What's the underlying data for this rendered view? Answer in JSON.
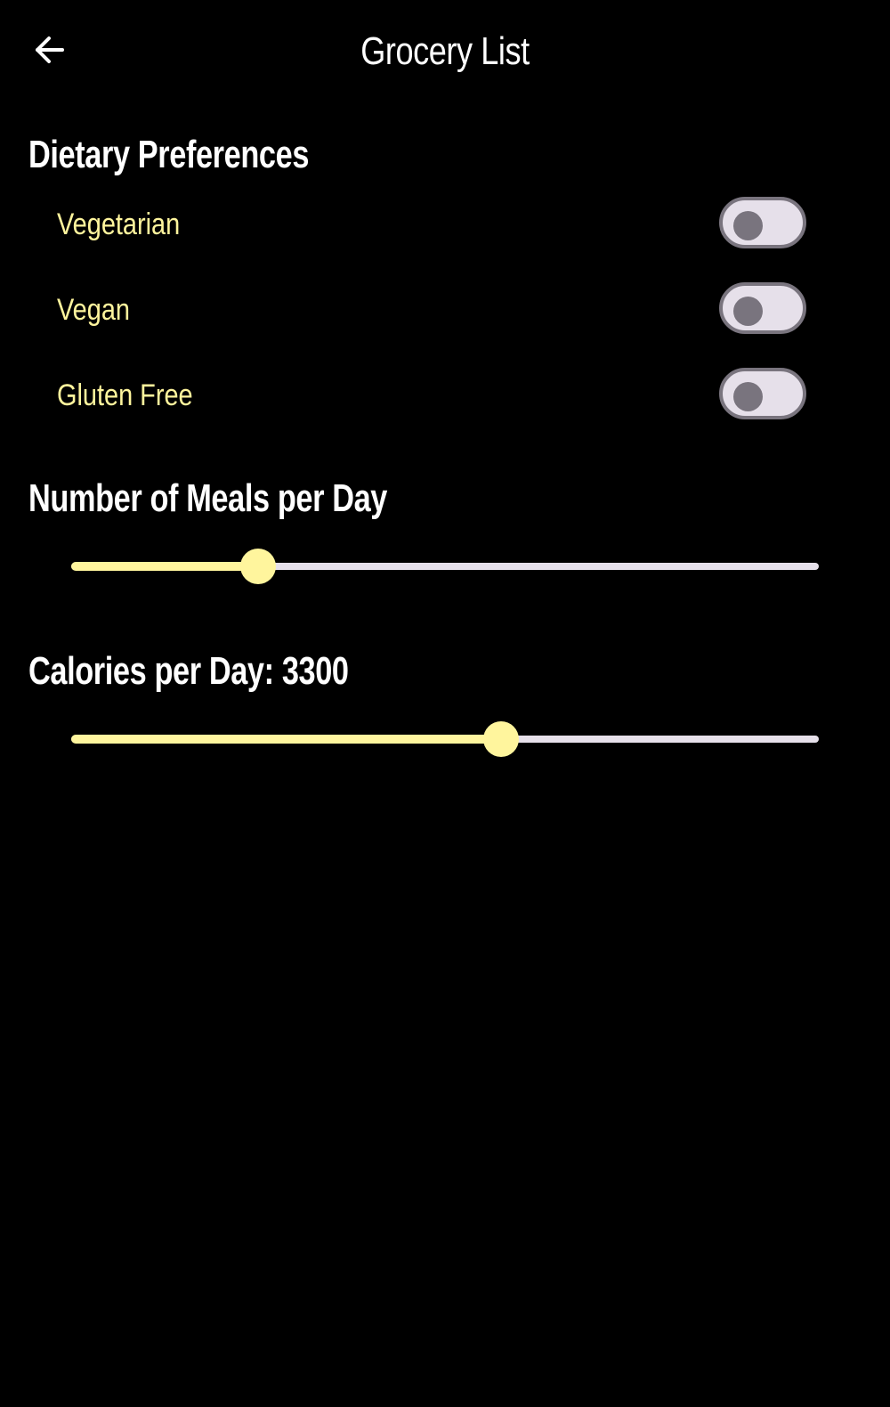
{
  "app_bar": {
    "title": "Grocery List",
    "back_icon": "arrow-left-icon"
  },
  "dietary": {
    "title": "Dietary Preferences",
    "items": [
      {
        "label": "Vegetarian",
        "on": false
      },
      {
        "label": "Vegan",
        "on": false
      },
      {
        "label": "Gluten Free",
        "on": false
      }
    ]
  },
  "meals": {
    "title": "Number of Meals per Day",
    "fraction": 0.25
  },
  "calories": {
    "title": "Calories per Day: 3300",
    "fraction": 0.575
  },
  "colors": {
    "background": "#000000",
    "accent": "#fff59d",
    "track_inactive": "#e6e0ea",
    "toggle_outline": "#79747e"
  }
}
